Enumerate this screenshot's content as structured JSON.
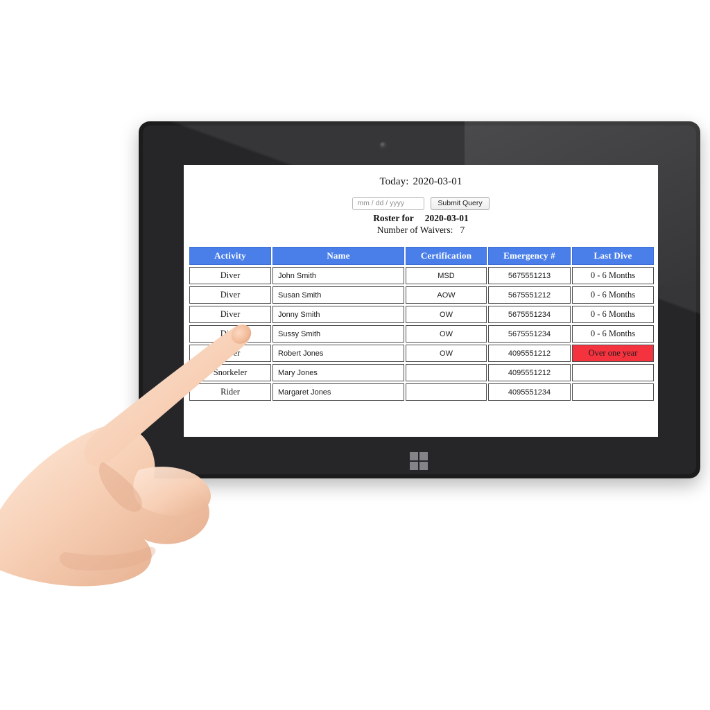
{
  "device": {
    "type": "windows-tablet",
    "home_button_icon": "windows-logo-icon",
    "camera_icon": "front-camera-icon"
  },
  "page": {
    "today_label": "Today:",
    "today_value": "2020-03-01",
    "date_input_placeholder": "mm / dd / yyyy",
    "date_input_value": "",
    "submit_label": "Submit Query",
    "roster_label": "Roster for",
    "roster_date": "2020-03-01",
    "waivers_label": "Number of Waivers:",
    "waivers_count": "7"
  },
  "table": {
    "headers": [
      "Activity",
      "Name",
      "Certification",
      "Emergency #",
      "Last Dive"
    ],
    "rows": [
      {
        "activity": "Diver",
        "name": "John Smith",
        "certification": "MSD",
        "emergency": "5675551213",
        "last_dive": "0 - 6 Months",
        "alert": false
      },
      {
        "activity": "Diver",
        "name": "Susan Smith",
        "certification": "AOW",
        "emergency": "5675551212",
        "last_dive": "0 - 6 Months",
        "alert": false
      },
      {
        "activity": "Diver",
        "name": "Jonny Smith",
        "certification": "OW",
        "emergency": "5675551234",
        "last_dive": "0 - 6 Months",
        "alert": false
      },
      {
        "activity": "Diver",
        "name": "Sussy Smith",
        "certification": "OW",
        "emergency": "5675551234",
        "last_dive": "0 - 6 Months",
        "alert": false
      },
      {
        "activity": "Diver",
        "name": "Robert Jones",
        "certification": "OW",
        "emergency": "4095551212",
        "last_dive": "Over one year",
        "alert": true
      },
      {
        "activity": "Snorkeler",
        "name": "Mary Jones",
        "certification": "",
        "emergency": "4095551212",
        "last_dive": "",
        "alert": false
      },
      {
        "activity": "Rider",
        "name": "Margaret Jones",
        "certification": "",
        "emergency": "4095551234",
        "last_dive": "",
        "alert": false
      }
    ]
  },
  "colors": {
    "header_blue": "#4a7fea",
    "alert_red": "#f5333f",
    "bezel_black": "#191919",
    "screen_white": "#ffffff",
    "skin": "#f3c9ad"
  },
  "pointer": {
    "gesture": "index-finger-pointing",
    "target_row_index": 2,
    "target_cell": "Activity"
  }
}
